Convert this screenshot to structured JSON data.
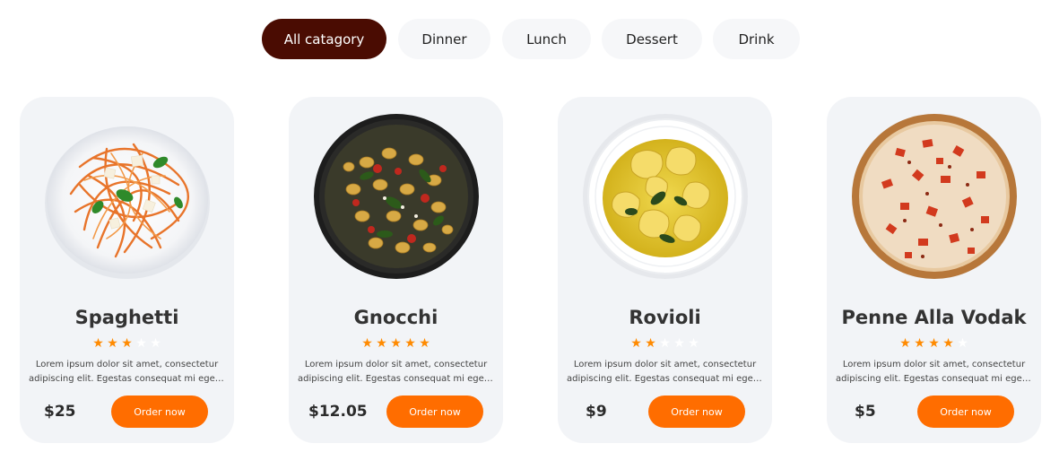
{
  "tabs": [
    {
      "label": "All catagory",
      "active": true
    },
    {
      "label": "Dinner",
      "active": false
    },
    {
      "label": "Lunch",
      "active": false
    },
    {
      "label": "Dessert",
      "active": false
    },
    {
      "label": "Drink",
      "active": false
    }
  ],
  "cards": [
    {
      "title": "Spaghetti",
      "rating": 3,
      "max_rating": 5,
      "desc_line1": "Lorem ipsum dolor sit amet, consectetur",
      "desc_line2": "adipiscing elit. Egestas consequat mi eget auctor",
      "price": "$25",
      "order_label": "Order now",
      "image": "spaghetti-plate"
    },
    {
      "title": "Gnocchi",
      "rating": 5,
      "max_rating": 5,
      "desc_line1": "Lorem ipsum dolor sit amet, consectetur",
      "desc_line2": "adipiscing elit. Egestas consequat mi eget auctor",
      "price": "$12.05",
      "order_label": "Order now",
      "image": "gnocchi-pan"
    },
    {
      "title": "Rovioli",
      "rating": 2,
      "max_rating": 5,
      "desc_line1": "Lorem ipsum dolor sit amet, consectetur",
      "desc_line2": "adipiscing elit. Egestas consequat mi eget auctor",
      "price": "$9",
      "order_label": "Order now",
      "image": "ravioli-bowl"
    },
    {
      "title": "Penne Alla Vodak",
      "rating": 4,
      "max_rating": 5,
      "desc_line1": "Lorem ipsum dolor sit amet, consectetur",
      "desc_line2": "adipiscing elit. Egestas consequat mi eget auctor",
      "price": "$5",
      "order_label": "Order now",
      "image": "pizza"
    }
  ],
  "colors": {
    "active_tab": "#4a0c02",
    "order_button": "#ff6d00",
    "star": "#ff8a00",
    "card_bg": "#f2f4f7"
  }
}
